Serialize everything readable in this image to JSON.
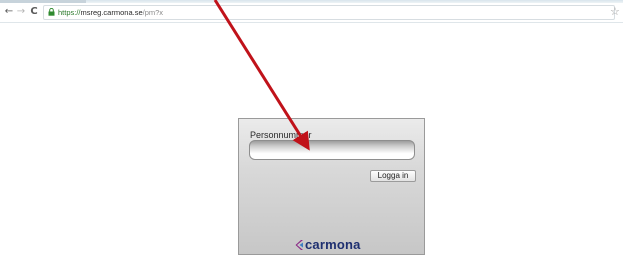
{
  "browser": {
    "url_scheme": "https://",
    "url_host": "msreg.carmona.se",
    "url_path": "/pm?x",
    "back_icon": "←",
    "forward_icon": "→",
    "reload_icon": "C",
    "star_icon": "☆"
  },
  "login": {
    "label": "Personnummer",
    "input_value": "",
    "button_label": "Logga in",
    "logo_text": "carmona"
  },
  "colors": {
    "arrow": "#c0121a",
    "logo_text": "#1e2f70",
    "logo_mark": "#8a2a86"
  }
}
